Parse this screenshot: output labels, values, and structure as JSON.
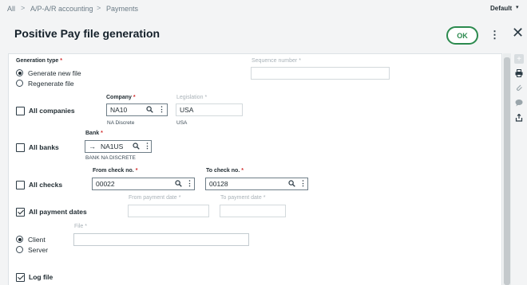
{
  "breadcrumb": [
    "All",
    "A/P-A/R accounting",
    "Payments"
  ],
  "breadcrumb_sep": ">",
  "header": {
    "default_label": "Default",
    "default_caret": "▾",
    "title": "Positive Pay file generation",
    "ok_label": "OK"
  },
  "form": {
    "generation_type": {
      "label": "Generation type",
      "options": [
        "Generate new file",
        "Regenerate file"
      ],
      "selected": "Generate new file"
    },
    "sequence_number": {
      "label": "Sequence number",
      "value": ""
    },
    "all_companies": {
      "label": "All companies",
      "checked": false
    },
    "company": {
      "label": "Company",
      "value": "NA10",
      "description": "NA Discrete"
    },
    "legislation": {
      "label": "Legislation",
      "value": "USA",
      "description": "USA"
    },
    "all_banks": {
      "label": "All banks",
      "checked": false
    },
    "bank": {
      "label": "Bank",
      "value": "NA1US",
      "description": "BANK NA DISCRETE"
    },
    "all_checks": {
      "label": "All checks",
      "checked": false
    },
    "from_check": {
      "label": "From check no.",
      "value": "00022"
    },
    "to_check": {
      "label": "To check no.",
      "value": "00128"
    },
    "all_payment_dates": {
      "label": "All payment dates",
      "checked": true
    },
    "from_payment_date": {
      "label": "From payment date",
      "value": ""
    },
    "to_payment_date": {
      "label": "To payment date",
      "value": ""
    },
    "destination": {
      "options": [
        "Client",
        "Server"
      ],
      "selected": "Client"
    },
    "file": {
      "label": "File",
      "value": ""
    },
    "log_file": {
      "label": "Log file",
      "checked": true
    }
  },
  "required_mark": "*",
  "icons": {
    "search": "search-icon",
    "more": "more-vert-icon",
    "arrow": "arrow-right-icon",
    "close": "close-icon"
  },
  "colors": {
    "accent_green": "#2b8a4e",
    "required_red": "#d12a2a"
  }
}
